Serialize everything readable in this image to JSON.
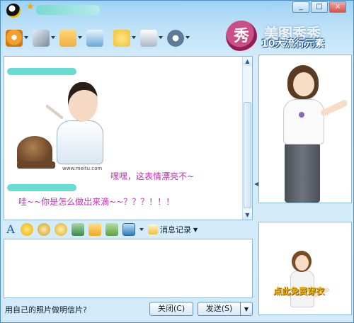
{
  "window": {
    "minimize": "_",
    "maximize": "□",
    "close": "×"
  },
  "brand": {
    "logo_char": "秀",
    "text": "10大流行元素",
    "watermark": "美图秀秀"
  },
  "toolbar": {
    "items": [
      {
        "icon": "qq-show-icon",
        "color": "#f2a030"
      },
      {
        "icon": "microphone-icon",
        "color": "#7c8a9a"
      },
      {
        "icon": "folder-icon",
        "color": "#f0b040"
      },
      {
        "icon": "mail-icon",
        "color": "#6aa8d8"
      },
      {
        "icon": "chat-bubble-icon",
        "color": "#f0c030"
      },
      {
        "icon": "card-game-icon",
        "color": "#a8b8c8"
      },
      {
        "icon": "settings-gear-icon",
        "color": "#5c7a9a"
      }
    ]
  },
  "chat": {
    "messages": [
      {
        "text": "嘿嘿，这表情漂亮不~"
      },
      {
        "text": "哇~~你是怎么做出来滴~~？？？！！！"
      }
    ],
    "emoticon_credit": "www.meitu.com"
  },
  "format_bar": {
    "font_icon": "A",
    "history_label": "消息记录"
  },
  "bottom": {
    "tip_link": "用自己的照片做明信片?",
    "close_label": "关闭(C)",
    "send_label": "发送(S)"
  },
  "side_panel": {
    "try_on_label": "点此免费穿衣"
  }
}
